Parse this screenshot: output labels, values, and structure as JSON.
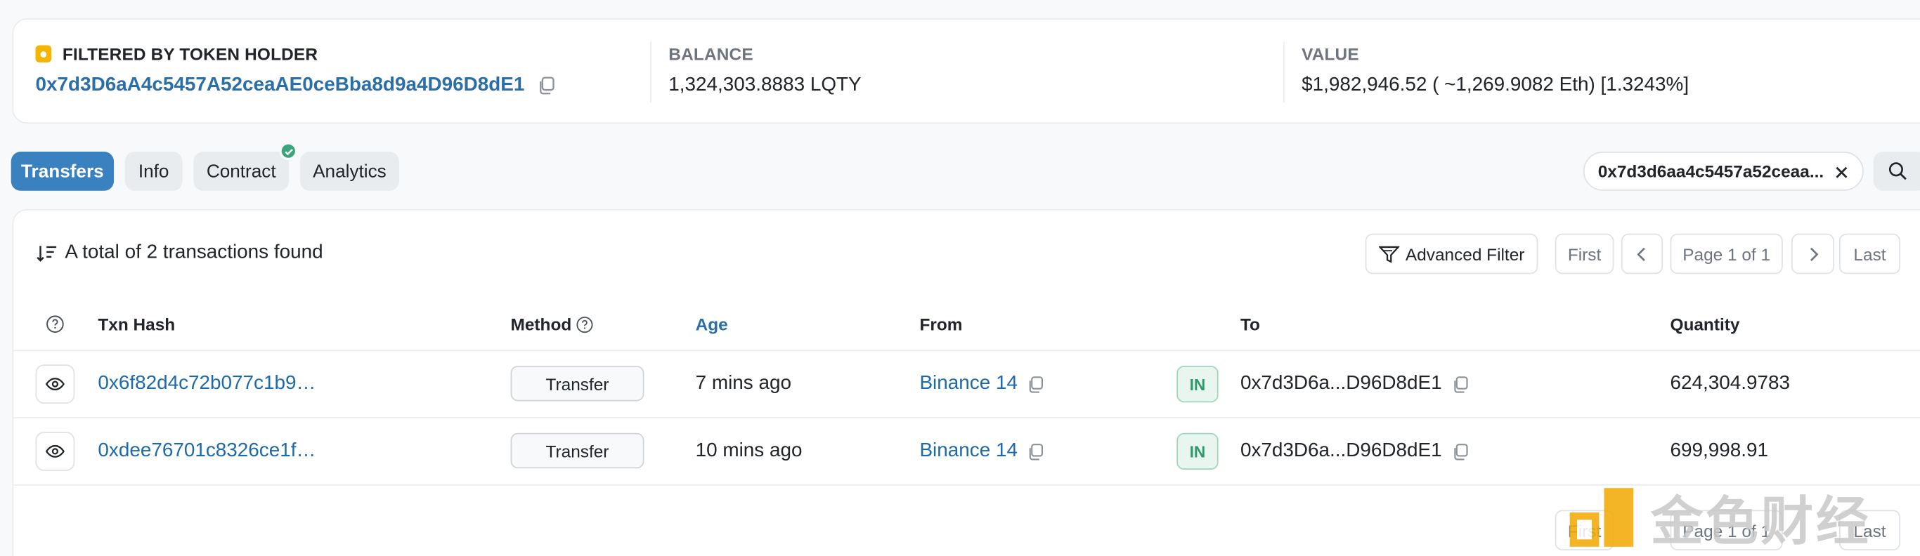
{
  "summary": {
    "holder_label": "FILTERED BY TOKEN HOLDER",
    "holder_address": "0x7d3D6aA4c5457A52ceaAE0ceBba8d9a4D96D8dE1",
    "balance_label": "BALANCE",
    "balance_value": "1,324,303.8883 LQTY",
    "value_label": "VALUE",
    "value_value": "$1,982,946.52 ( ~1,269.9082 Eth) [1.3243%]"
  },
  "tabs": [
    {
      "label": "Transfers",
      "active": true
    },
    {
      "label": "Info",
      "active": false
    },
    {
      "label": "Contract",
      "active": false,
      "verified": true
    },
    {
      "label": "Analytics",
      "active": false
    }
  ],
  "filter_chip": {
    "text": "0x7d3d6aa4c5457a52ceaa..."
  },
  "list": {
    "total_text": "A total of 2 transactions found",
    "advanced_filter": "Advanced Filter",
    "pager": {
      "first": "First",
      "page": "Page 1 of 1",
      "last": "Last"
    }
  },
  "columns": {
    "txn_hash": "Txn Hash",
    "method": "Method",
    "age": "Age",
    "from": "From",
    "to": "To",
    "quantity": "Quantity"
  },
  "rows": [
    {
      "hash": "0x6f82d4c72b077c1b9…",
      "method": "Transfer",
      "age": "7 mins ago",
      "from": "Binance 14",
      "direction": "IN",
      "to": "0x7d3D6a...D96D8dE1",
      "quantity": "624,304.9783"
    },
    {
      "hash": "0xdee76701c8326ce1f…",
      "method": "Transfer",
      "age": "10 mins ago",
      "from": "Binance 14",
      "direction": "IN",
      "to": "0x7d3D6a...D96D8dE1",
      "quantity": "699,998.91"
    }
  ],
  "watermark": {
    "text": "金色财经",
    "logo": "jinse-logo-icon"
  },
  "colors": {
    "accent": "#3a81c0",
    "link": "#2a6fa8",
    "in_badge": "#2d9a6a",
    "verified": "#3aa47a"
  }
}
